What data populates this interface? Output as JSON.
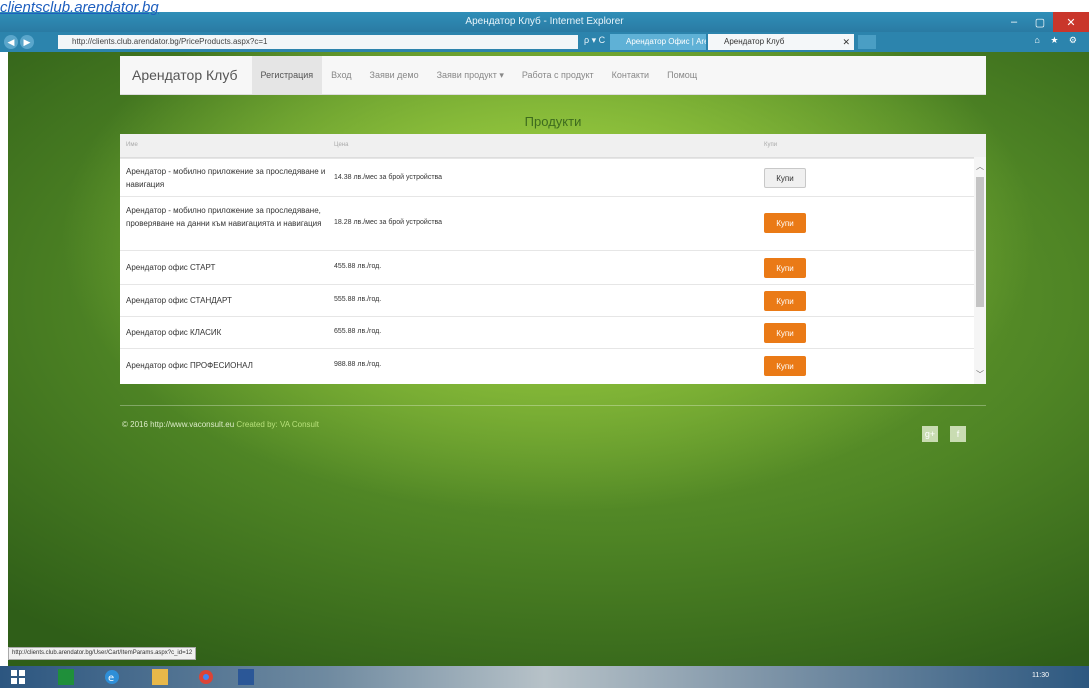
{
  "top_link": "clientsclub.arendator.bg",
  "window": {
    "title": "Арендатор Клуб - Internet Explorer",
    "controls": [
      "–",
      "▢",
      "✕"
    ]
  },
  "browser": {
    "url": "http://clients.club.arendator.bg/PriceProducts.aspx?c=1",
    "url_tools": "ρ ▾ C",
    "tabs": [
      {
        "label": "Арендатор Офис | Arendat..."
      },
      {
        "label": "Арендатор Клуб",
        "close": "✕"
      }
    ],
    "tools": "⌂ ★ ⚙"
  },
  "navbar": {
    "brand": "Арендатор Клуб",
    "items": [
      "Регистрация",
      "Вход",
      "Заяви демо",
      "Заяви продукт ▾",
      "Работа с продукт",
      "Контакти",
      "Помощ"
    ]
  },
  "page_title": "Продукти",
  "table": {
    "headers": [
      "Име",
      "Цена",
      "Купи"
    ],
    "rows": [
      {
        "name": "Арендатор - мобилно приложение за проследяване и навигация",
        "price": "14.38 лв./мес за брой устройства",
        "button": "Купи",
        "style": "grey"
      },
      {
        "name": "Арендатор - мобилно приложение за проследяване, проверяване на данни към навигацията и навигация",
        "price": "18.28 лв./мес за брой устройства",
        "button": "Купи",
        "style": "orange"
      },
      {
        "name": "Арендатор офис СТАРТ",
        "price": "455.88 лв./год.",
        "button": "Купи",
        "style": "orange"
      },
      {
        "name": "Арендатор офис СТАНДАРТ",
        "price": "555.88 лв./год.",
        "button": "Купи",
        "style": "orange"
      },
      {
        "name": "Арендатор офис КЛАСИК",
        "price": "655.88 лв./год.",
        "button": "Купи",
        "style": "orange"
      },
      {
        "name": "Арендатор офис ПРОФЕСИОНАЛ",
        "price": "988.88 лв./год.",
        "button": "Купи",
        "style": "orange"
      }
    ]
  },
  "footer": {
    "copyright": "© 2016 http://www.vaconsult.eu",
    "links": "Created by: VA Consult",
    "social": [
      "g+",
      "f"
    ]
  },
  "status_url": "http://clients.club.arendator.bg/User/Cart/ItemParams.aspx?c_id=12",
  "clock": "11:30"
}
